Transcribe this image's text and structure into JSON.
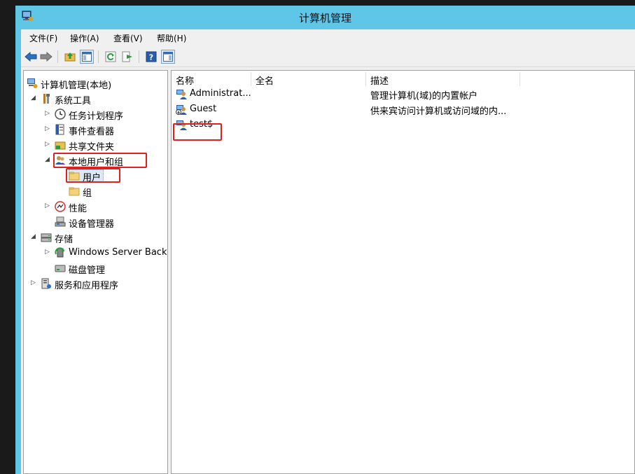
{
  "window": {
    "title": "计算机管理"
  },
  "menu": [
    {
      "label": "文件(F)"
    },
    {
      "label": "操作(A)"
    },
    {
      "label": "查看(V)"
    },
    {
      "label": "帮助(H)"
    }
  ],
  "toolbar": {
    "buttons": [
      "back-arrow-icon",
      "forward-arrow-icon",
      "up-folder-icon",
      "show-hide-tree-icon",
      "refresh-icon",
      "export-list-icon",
      "help-icon",
      "show-hide-action-pane-icon"
    ]
  },
  "tree": {
    "root": "计算机管理(本地)",
    "system_tools": "系统工具",
    "task_scheduler": "任务计划程序",
    "event_viewer": "事件查看器",
    "shared_folders": "共享文件夹",
    "local_users_groups": "本地用户和组",
    "users": "用户",
    "groups": "组",
    "performance": "性能",
    "device_manager": "设备管理器",
    "storage": "存储",
    "windows_server_backup": "Windows Server Back",
    "disk_management": "磁盘管理",
    "services_apps": "服务和应用程序"
  },
  "list": {
    "columns": [
      "名称",
      "全名",
      "描述"
    ],
    "rows": [
      {
        "name": "Administrat...",
        "full_name": "",
        "description": "管理计算机(域)的内置帐户"
      },
      {
        "name": "Guest",
        "full_name": "",
        "description": "供来宾访问计算机或访问域的内..."
      },
      {
        "name": "test$",
        "full_name": "",
        "description": ""
      }
    ]
  },
  "colors": {
    "titlebar": "#5fc6e8",
    "highlight": "#e02020",
    "selection": "#dde8f6"
  }
}
